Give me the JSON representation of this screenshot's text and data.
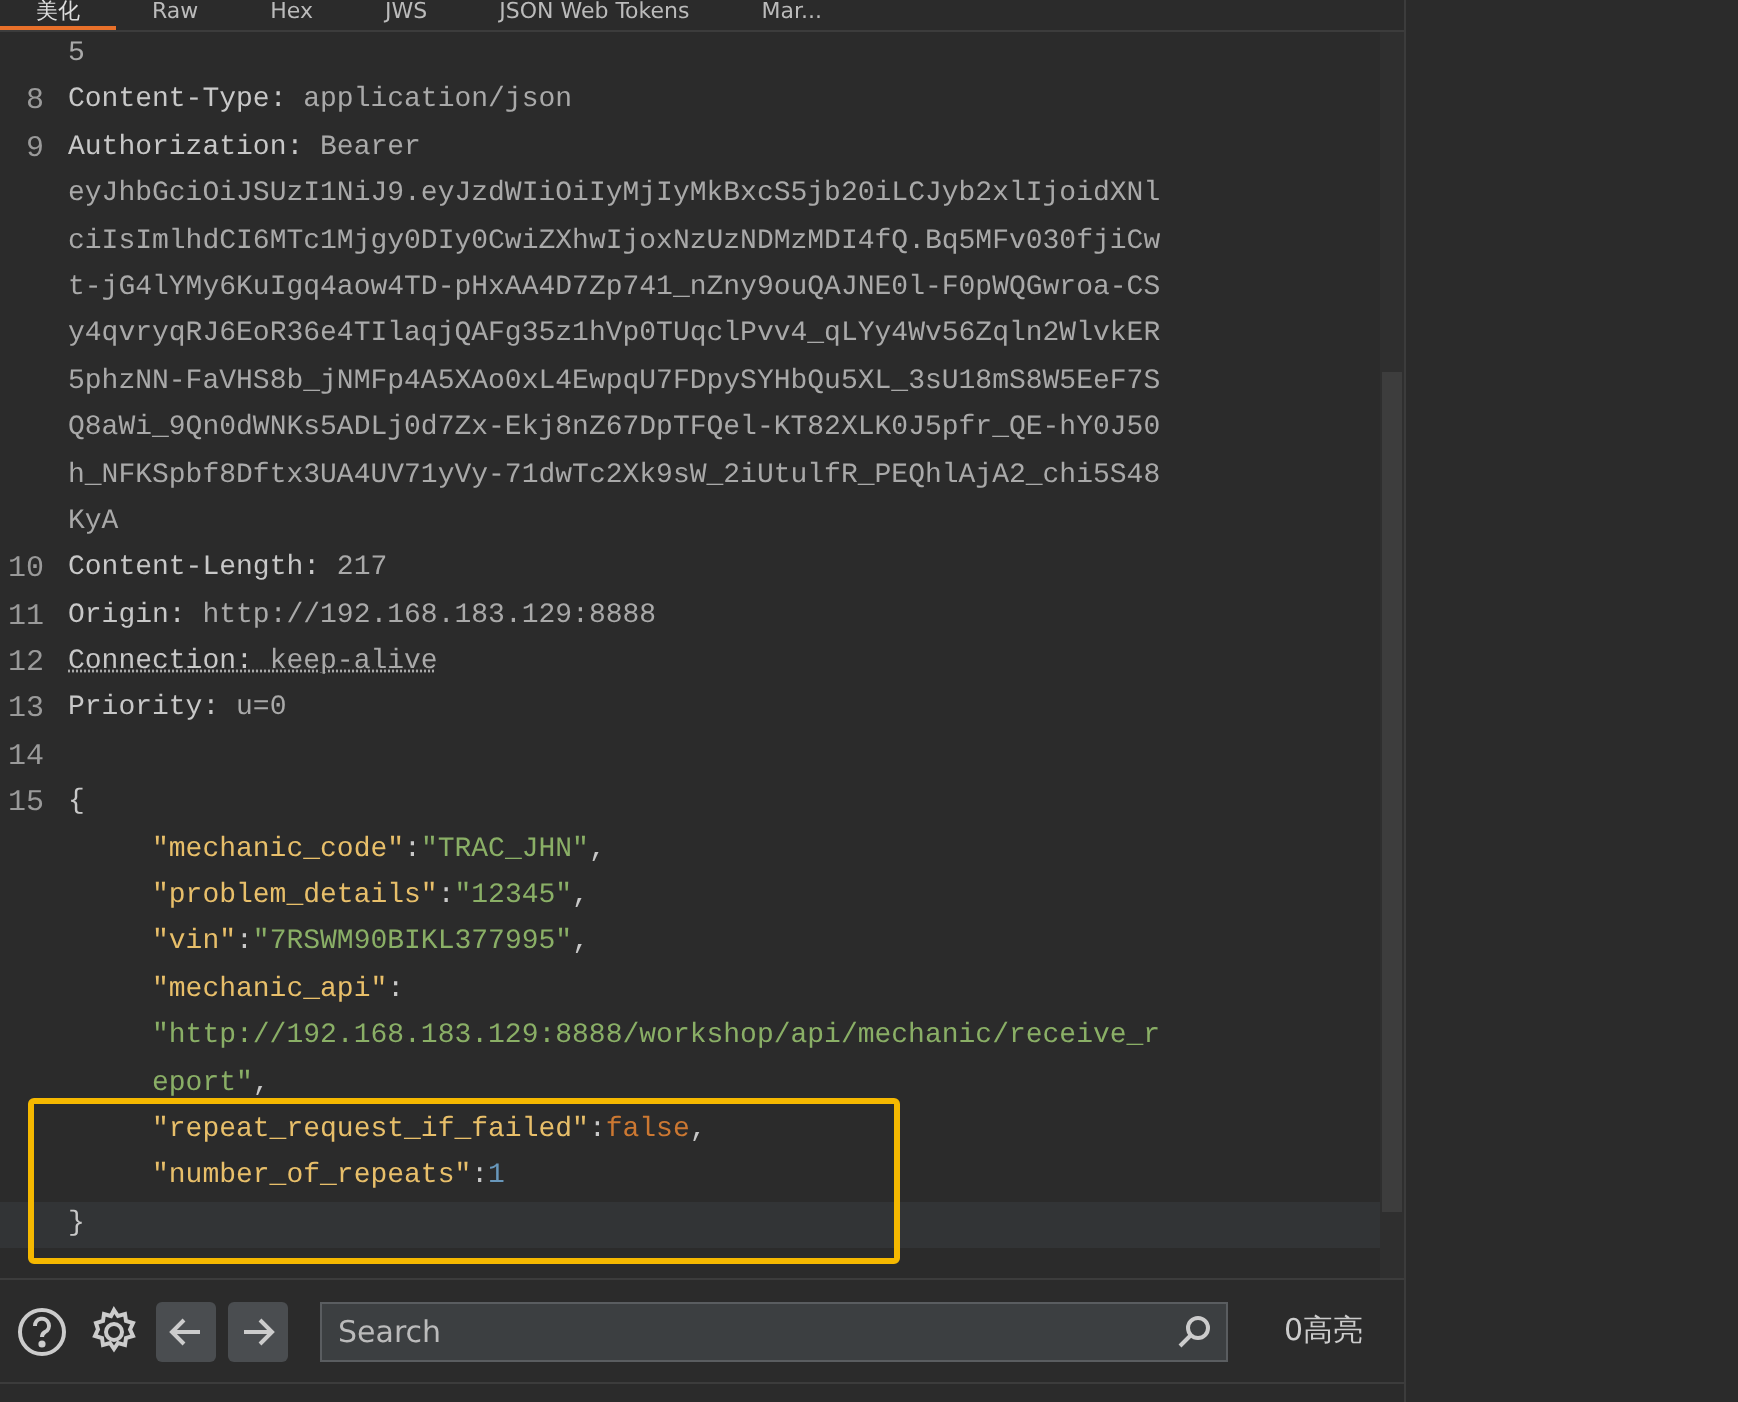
{
  "tabs": [
    {
      "label": "美化",
      "selected": true
    },
    {
      "label": "Raw",
      "selected": false
    },
    {
      "label": "Hex",
      "selected": false
    },
    {
      "label": "JWS",
      "selected": false
    },
    {
      "label": "JSON Web Tokens",
      "selected": false
    },
    {
      "label": "Mar...",
      "selected": false
    }
  ],
  "editor": {
    "rows": [
      {
        "segments": [
          {
            "kind": "value",
            "text": "5"
          }
        ]
      },
      {
        "number": "8",
        "segments": [
          {
            "kind": "name",
            "text": "Content-Type:"
          },
          {
            "kind": "value",
            "text": " application/json"
          }
        ]
      },
      {
        "number": "9",
        "segments": [
          {
            "kind": "name",
            "text": "Authorization:"
          },
          {
            "kind": "value",
            "text": " Bearer"
          }
        ]
      },
      {
        "segments": [
          {
            "kind": "value",
            "text": "eyJhbGciOiJSUzI1NiJ9.eyJzdWIiOiIyMjIyMkBxcS5jb20iLCJyb2xlIjoidXNl"
          }
        ]
      },
      {
        "segments": [
          {
            "kind": "value",
            "text": "ciIsImlhdCI6MTc1Mjgy0DIy0CwiZXhwIjoxNzUzNDMzMDI4fQ.Bq5MFv030fjiCw"
          }
        ]
      },
      {
        "segments": [
          {
            "kind": "value",
            "text": "t-jG4lYMy6KuIgq4aow4TD-pHxAA4D7Zp741_nZny9ouQAJNE0l-F0pWQGwroa-CS"
          }
        ]
      },
      {
        "segments": [
          {
            "kind": "value",
            "text": "y4qvryqRJ6EoR36e4TIlaqjQAFg35z1hVp0TUqclPvv4_qLYy4Wv56Zqln2WlvkER"
          }
        ]
      },
      {
        "segments": [
          {
            "kind": "value",
            "text": "5phzNN-FaVHS8b_jNMFp4A5XAo0xL4EwpqU7FDpySYHbQu5XL_3sU18mS8W5EeF7S"
          }
        ]
      },
      {
        "segments": [
          {
            "kind": "value",
            "text": "Q8aWi_9Qn0dWNKs5ADLj0d7Zx-Ekj8nZ67DpTFQel-KT82XLK0J5pfr_QE-hY0J50"
          }
        ]
      },
      {
        "segments": [
          {
            "kind": "value",
            "text": "h_NFKSpbf8Dftx3UA4UV71yVy-71dwTc2Xk9sW_2iUtulfR_PEQhlAjA2_chi5S48"
          }
        ]
      },
      {
        "segments": [
          {
            "kind": "value",
            "text": "KyA"
          }
        ]
      },
      {
        "number": "10",
        "segments": [
          {
            "kind": "name",
            "text": "Content-Length:"
          },
          {
            "kind": "value",
            "text": " 217"
          }
        ]
      },
      {
        "number": "11",
        "segments": [
          {
            "kind": "name",
            "text": "Origin:"
          },
          {
            "kind": "value",
            "text": " http://192.168.183.129:8888"
          }
        ]
      },
      {
        "number": "12",
        "underlined": true,
        "segments": [
          {
            "kind": "name",
            "text": "Connection:"
          },
          {
            "kind": "value",
            "text": " keep-alive"
          }
        ]
      },
      {
        "number": "13",
        "segments": [
          {
            "kind": "name",
            "text": "Priority:"
          },
          {
            "kind": "value",
            "text": " u=0"
          }
        ]
      },
      {
        "number": "14",
        "segments": []
      },
      {
        "number": "15",
        "segments": [
          {
            "kind": "punct",
            "text": "{"
          }
        ]
      },
      {
        "indented": true,
        "segments": [
          {
            "kind": "key",
            "text": "\"mechanic_code\""
          },
          {
            "kind": "punct",
            "text": ":"
          },
          {
            "kind": "string",
            "text": "\"TRAC_JHN\""
          },
          {
            "kind": "punct",
            "text": ","
          }
        ]
      },
      {
        "indented": true,
        "segments": [
          {
            "kind": "key",
            "text": "\"problem_details\""
          },
          {
            "kind": "punct",
            "text": ":"
          },
          {
            "kind": "string",
            "text": "\"12345\""
          },
          {
            "kind": "punct",
            "text": ","
          }
        ]
      },
      {
        "indented": true,
        "segments": [
          {
            "kind": "key",
            "text": "\"vin\""
          },
          {
            "kind": "punct",
            "text": ":"
          },
          {
            "kind": "string",
            "text": "\"7RSWM90BIKL377995\""
          },
          {
            "kind": "punct",
            "text": ","
          }
        ]
      },
      {
        "indented": true,
        "segments": [
          {
            "kind": "key",
            "text": "\"mechanic_api\""
          },
          {
            "kind": "punct",
            "text": ":"
          }
        ]
      },
      {
        "indented": true,
        "segments": [
          {
            "kind": "string",
            "text": "\"http://192.168.183.129:8888/workshop/api/mechanic/receive_r"
          }
        ]
      },
      {
        "indented": true,
        "segments": [
          {
            "kind": "string",
            "text": "eport\""
          },
          {
            "kind": "punct",
            "text": ","
          }
        ]
      },
      {
        "highlighted": true,
        "indented": true,
        "segments": [
          {
            "kind": "key",
            "text": "\"repeat_request_if_failed\""
          },
          {
            "kind": "punct",
            "text": ":"
          },
          {
            "kind": "boolean",
            "text": "false"
          },
          {
            "kind": "punct",
            "text": ","
          }
        ]
      },
      {
        "highlighted": true,
        "indented": true,
        "segments": [
          {
            "kind": "key",
            "text": "\"number_of_repeats\""
          },
          {
            "kind": "punct",
            "text": ":"
          },
          {
            "kind": "number",
            "text": "1"
          }
        ]
      },
      {
        "highlighted": true,
        "current": true,
        "segments": [
          {
            "kind": "punct",
            "text": "}"
          }
        ]
      }
    ]
  },
  "footer": {
    "search_placeholder": "Search",
    "highlight_count": "0高亮"
  }
}
